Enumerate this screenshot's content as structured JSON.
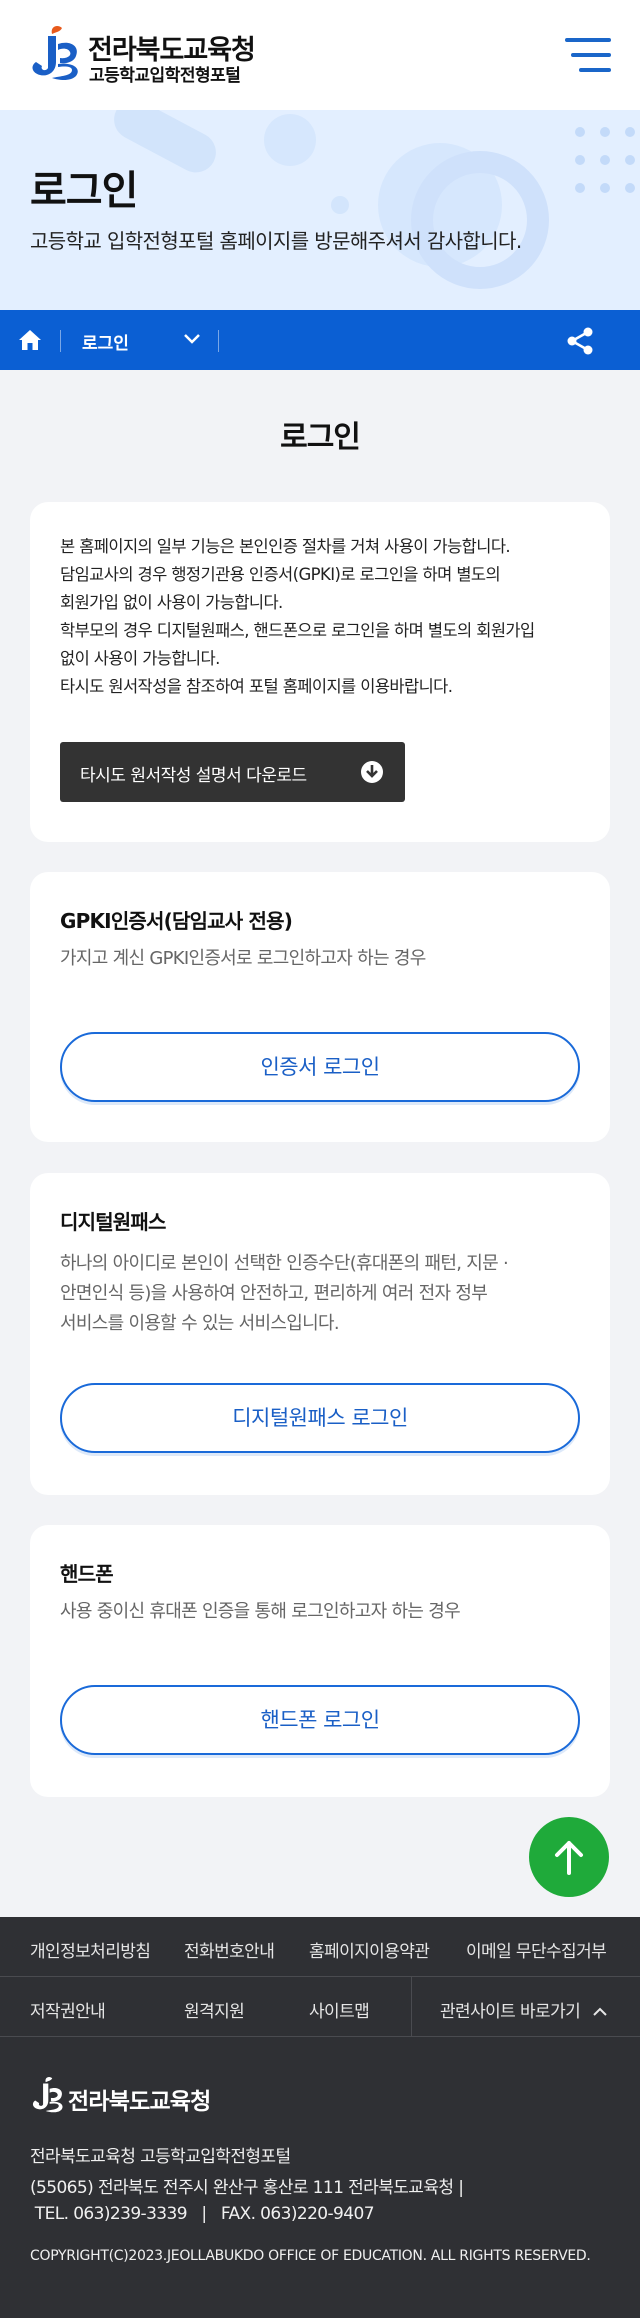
{
  "header": {
    "org_name": "전라북도교육청",
    "site_name": "고등학교입학전형포털",
    "menu_icon": "hamburger-menu-icon"
  },
  "hero": {
    "title": "로그인",
    "subtitle": "고등학교 입학전형포털 홈페이지를 방문해주셔서 감사합니다."
  },
  "breadcrumb": {
    "home_icon": "home-icon",
    "current": "로그인",
    "share_icon": "share-icon"
  },
  "page_title": "로그인",
  "notice": {
    "lines": [
      "본 홈페이지의 일부 기능은 본인인증 절차를 거쳐 사용이 가능합니다.",
      "담임교사의 경우 행정기관용 인증서(GPKI)로 로그인을 하며 별도의",
      "회원가입 없이 사용이 가능합니다.",
      "학부모의 경우 디지털원패스, 핸드폰으로 로그인을 하며 별도의 회원가입",
      "없이 사용이 가능합니다.",
      "타시도 원서작성을 참조하여 포털 홈페이지를 이용바랍니다."
    ],
    "download_label": "타시도 원서작성 설명서 다운로드"
  },
  "gpki": {
    "title": "GPKI인증서(담임교사 전용)",
    "desc": "가지고 계신 GPKI인증서로 로그인하고자 하는 경우",
    "button": "인증서 로그인"
  },
  "onepass": {
    "title": "디지털원패스",
    "desc_lines": [
      "하나의 아이디로 본인이 선택한 인증수단(휴대폰의 패턴, 지문 ·",
      "안면인식 등)을 사용하여 안전하고, 편리하게 여러 전자 정부",
      "서비스를 이용할 수 있는 서비스입니다."
    ],
    "button": "디지털원패스 로그인"
  },
  "phone": {
    "title": "핸드폰",
    "desc": "사용 중이신 휴대폰 인증을 통해 로그인하고자 하는 경우",
    "button": "핸드폰 로그인"
  },
  "footer": {
    "links_row1": [
      "개인정보처리방침",
      "전화번호안내",
      "홈페이지이용약관",
      "이메일 무단수집거부"
    ],
    "links_row2": [
      "저작권안내",
      "원격지원",
      "사이트맵"
    ],
    "related_sites": "관련사이트 바로가기",
    "org_name": "전라북도교육청",
    "info_lines": [
      "전라북도교육청 고등학교입학전형포털",
      "(55065) 전라북도 전주시 완산구 홍산로 111 전라북도교육청  |",
      " TEL. 063)239-3339   |   FAX. 063)220-9407"
    ],
    "copyright": "COPYRIGHT(C)2023.JEOLLABUKDO OFFICE OF EDUCATION. ALL RIGHTS RESERVED."
  },
  "colors": {
    "primary_blue": "#0b5fd3",
    "button_blue": "#1a6ad9",
    "top_button_green": "#1faa3a",
    "footer_bg": "#2f3034",
    "hero_bg": "#e3efff"
  }
}
